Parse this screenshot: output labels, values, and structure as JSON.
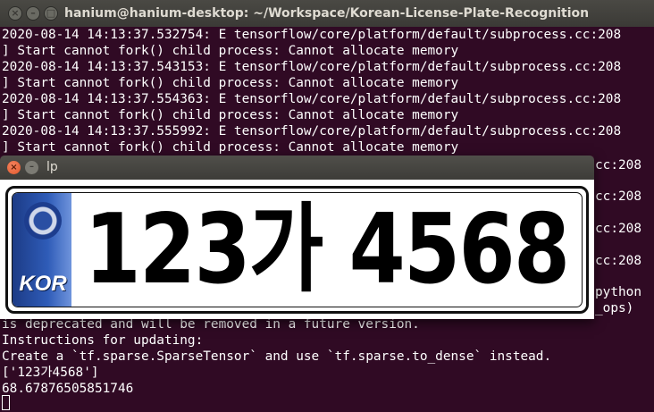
{
  "terminal": {
    "title": "hanium@hanium-desktop: ~/Workspace/Korean-License-Plate-Recognition",
    "lines_top": [
      "2020-08-14 14:13:37.532754: E tensorflow/core/platform/default/subprocess.cc:208",
      "] Start cannot fork() child process: Cannot allocate memory",
      "2020-08-14 14:13:37.543153: E tensorflow/core/platform/default/subprocess.cc:208",
      "] Start cannot fork() child process: Cannot allocate memory",
      "2020-08-14 14:13:37.554363: E tensorflow/core/platform/default/subprocess.cc:208",
      "] Start cannot fork() child process: Cannot allocate memory",
      "2020-08-14 14:13:37.555992: E tensorflow/core/platform/default/subprocess.cc:208",
      "] Start cannot fork() child process: Cannot allocate memory"
    ],
    "right_fragments": [
      "cc:208",
      "cc:208",
      "cc:208",
      "cc:208",
      "python",
      "_ops)"
    ],
    "lines_bottom": [
      "is deprecated and will be removed in a future version.",
      "Instructions for updating:",
      "Create a `tf.sparse.SparseTensor` and use `tf.sparse.to_dense` instead.",
      "['123가4568']",
      "68.67876505851746"
    ]
  },
  "lp_window": {
    "title": "lp",
    "plate": {
      "country_code": "KOR",
      "number": "123가 4568"
    }
  },
  "colors": {
    "terminal_bg": "#300a24",
    "terminal_fg": "#ffffff",
    "plate_band": "#2f5cb8"
  }
}
